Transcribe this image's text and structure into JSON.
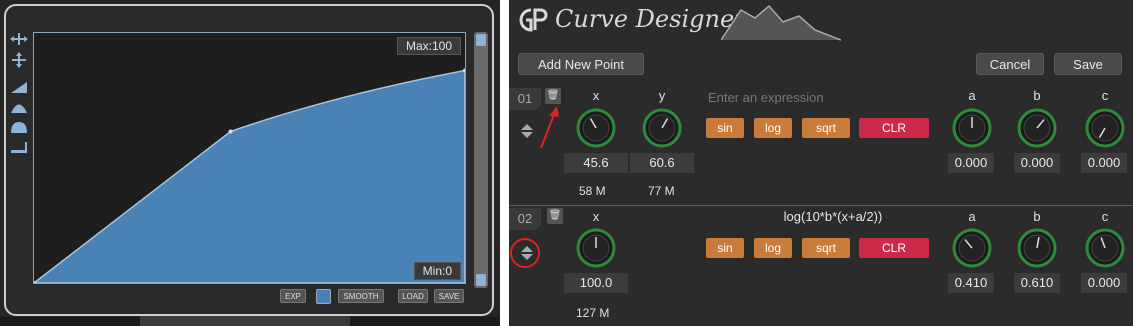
{
  "graph": {
    "max_label": "Max:100",
    "min_label": "Min:0",
    "curve_points": [
      [
        0,
        0
      ],
      [
        45.6,
        60.6
      ],
      [
        100,
        85
      ]
    ]
  },
  "left_toolbar": {
    "icons": [
      "horizontal-expand-icon",
      "vertical-expand-icon",
      "ramp-icon",
      "arc-icon",
      "double-arc-icon",
      "step-ramp-icon"
    ]
  },
  "bottom_controls": {
    "exp": "EXP",
    "smooth": "SMOOTH",
    "load": "LOAD",
    "save": "SAVE"
  },
  "app": {
    "title": "Curve Designer"
  },
  "toolbar": {
    "add_point": "Add New Point",
    "cancel": "Cancel",
    "save": "Save"
  },
  "functions": {
    "sin": "sin",
    "log": "log",
    "sqrt": "sqrt",
    "clr": "CLR"
  },
  "rows": [
    {
      "num": "01",
      "x_label": "x",
      "y_label": "y",
      "expression_placeholder": "Enter an expression",
      "x_value": "45.6",
      "y_value": "60.6",
      "x_sub": "58 M",
      "y_sub": "77 M",
      "a_label": "a",
      "b_label": "b",
      "c_label": "c",
      "a_value": "0.000",
      "b_value": "0.000",
      "c_value": "0.000"
    },
    {
      "num": "02",
      "x_label": "x",
      "expression": "log(10*b*(x+a/2))",
      "x_value": "100.0",
      "x_sub": "127 M",
      "a_label": "a",
      "b_label": "b",
      "c_label": "c",
      "a_value": "0.410",
      "b_value": "0.610",
      "c_value": "0.000"
    }
  ],
  "colors": {
    "curve_fill": "#4a82b6",
    "knob_ring": "#2e8b3a",
    "function_button": "#c97b3a",
    "clear_button": "#cc2a4b",
    "annotation": "#e02020"
  }
}
